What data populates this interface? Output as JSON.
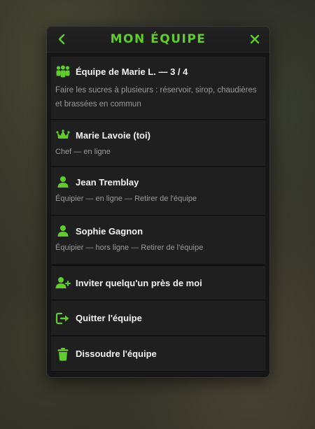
{
  "header": {
    "title": "MON ÉQUIPE"
  },
  "team": {
    "title": "Équipe de Marie L. — 3 / 4",
    "description": "Faire les sucres à plusieurs : réservoir, sirop, chaudières et brassées en commun"
  },
  "members": [
    {
      "name": "Marie Lavoie (toi)",
      "status": "Chef — en ligne",
      "icon": "crown-icon"
    },
    {
      "name": "Jean Tremblay",
      "status": "Équipier — en ligne — Retirer de l'équipe",
      "icon": "person-icon"
    },
    {
      "name": "Sophie Gagnon",
      "status": "Équipier — hors ligne — Retirer de l'équipe",
      "icon": "person-icon"
    }
  ],
  "actions": {
    "invite": "Inviter quelqu'un près de moi",
    "leave": "Quitter l'équipe",
    "disband": "Dissoudre l'équipe"
  },
  "colors": {
    "accent": "#5fce2a",
    "panel": "#161616",
    "row": "#1f1f1f",
    "text": "#f2f2f2",
    "muted": "#9a9a9a"
  }
}
